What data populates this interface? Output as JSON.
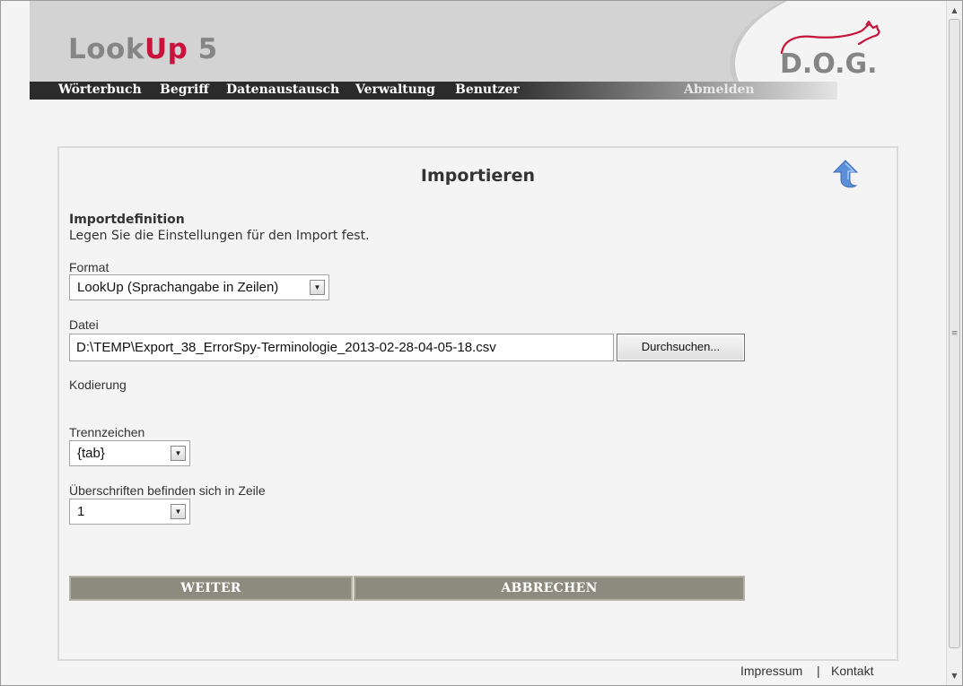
{
  "header": {
    "logo": {
      "part1": "Look",
      "part2": "Up",
      "version": "5"
    },
    "brand_logo_text": "D.O.G."
  },
  "nav": {
    "items": [
      "Wörterbuch",
      "Begriff",
      "Datenaustausch",
      "Verwaltung",
      "Benutzer"
    ],
    "logout": "Abmelden"
  },
  "panel": {
    "title": "Importieren",
    "heading": "Importdefinition",
    "description": "Legen Sie die Einstellungen für den Import fest.",
    "format": {
      "label": "Format",
      "value": "LookUp (Sprachangabe in Zeilen)"
    },
    "file": {
      "label": "Datei",
      "value": "D:\\TEMP\\Export_38_ErrorSpy-Terminologie_2013-02-28-04-05-18.csv",
      "browse_label": "Durchsuchen..."
    },
    "encoding": {
      "label": "Kodierung"
    },
    "separator": {
      "label": "Trennzeichen",
      "value": "{tab}"
    },
    "header_row": {
      "label": "Überschriften befinden sich in Zeile",
      "value": "1"
    },
    "next_label": "WEITER",
    "cancel_label": "ABBRECHEN"
  },
  "footer": {
    "imprint": "Impressum",
    "separator": "|",
    "contact": "Kontakt"
  },
  "colors": {
    "accent": "#c8143c",
    "nav_bg": "#2b2b2b",
    "button_bg": "#8d8a7e",
    "up_icon": "#5b8fd8"
  }
}
